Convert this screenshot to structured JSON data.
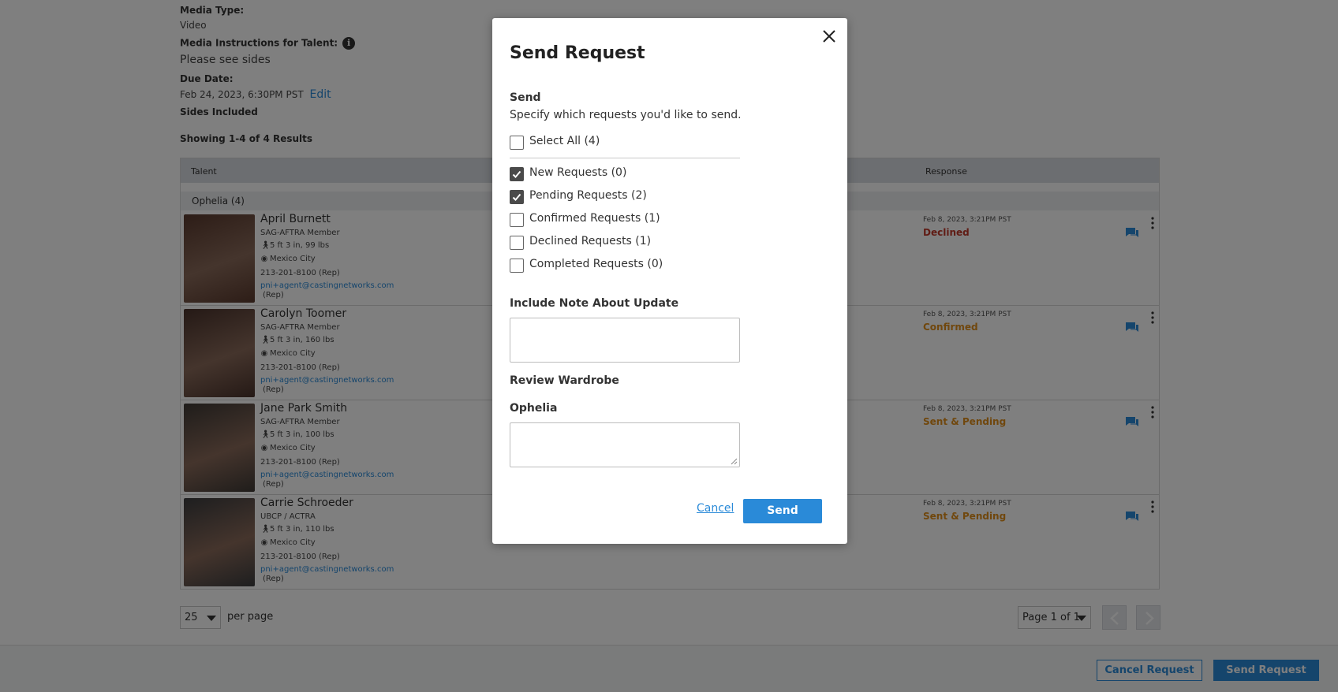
{
  "details": {
    "media_type_label": "Media Type:",
    "media_type_value": "Video",
    "instructions_label": "Media Instructions for Talent:",
    "instructions_value": "Please see sides",
    "due_date_label": "Due Date:",
    "due_date_value": "Feb 24, 2023, 6:30PM PST",
    "edit_label": "Edit",
    "sides_label": "Sides Included",
    "results_label": "Showing 1-4 of 4 Results"
  },
  "table": {
    "col_talent": "Talent",
    "col_response": "Response",
    "group_label": "Ophelia (4)",
    "rows": [
      {
        "name": "April Burnett",
        "union": "SAG-AFTRA Member",
        "size": "5 ft 3 in, 99 lbs",
        "location": "Mexico City",
        "phone": "213-201-8100 (Rep)",
        "email": "pni+agent@castingnetworks.com",
        "rep": "(Rep)",
        "date": "Feb 8, 2023, 3:21PM PST",
        "status": "Declined",
        "status_color": "#c0392b",
        "photo_color": "#5a3a2e"
      },
      {
        "name": "Carolyn Toomer",
        "union": "SAG-AFTRA Member",
        "size": "5 ft 3 in, 160 lbs",
        "location": "Mexico City",
        "phone": "213-201-8100 (Rep)",
        "email": "pni+agent@castingnetworks.com",
        "rep": "(Rep)",
        "date": "Feb 8, 2023, 3:21PM PST",
        "status": "Confirmed",
        "status_color": "#e08e1a",
        "photo_color": "#4a332c"
      },
      {
        "name": "Jane Park Smith",
        "union": "SAG-AFTRA Member",
        "size": "5 ft 3 in, 100 lbs",
        "location": "Mexico City",
        "phone": "213-201-8100 (Rep)",
        "email": "pni+agent@castingnetworks.com",
        "rep": "(Rep)",
        "date": "Feb 8, 2023, 3:21PM PST",
        "status": "Sent & Pending",
        "status_color": "#e08e1a",
        "photo_color": "#3f3a36"
      },
      {
        "name": "Carrie Schroeder",
        "union": "UBCP / ACTRA",
        "size": "5 ft 3 in, 110 lbs",
        "location": "Mexico City",
        "phone": "213-201-8100 (Rep)",
        "email": "pni+agent@castingnetworks.com",
        "rep": "(Rep)",
        "date": "Feb 8, 2023, 3:21PM PST",
        "status": "Sent & Pending",
        "status_color": "#e08e1a",
        "photo_color": "#3c3d3f"
      }
    ]
  },
  "pagination": {
    "per_page_value": "25",
    "per_page_label": "per page",
    "page_select": "Page 1 of 1"
  },
  "footer": {
    "cancel_request": "Cancel Request",
    "send_request": "Send Request"
  },
  "modal": {
    "title": "Send Request",
    "send_heading": "Send",
    "send_sub": "Specify which requests you'd like to send.",
    "select_all": "Select All (4)",
    "options": [
      {
        "label": "New Requests (0)",
        "checked": true
      },
      {
        "label": "Pending Requests (2)",
        "checked": true
      },
      {
        "label": "Confirmed Requests (1)",
        "checked": false
      },
      {
        "label": "Declined Requests (1)",
        "checked": false
      },
      {
        "label": "Completed Requests (0)",
        "checked": false
      }
    ],
    "note_heading": "Include Note About Update",
    "wardrobe_heading": "Review Wardrobe",
    "role_heading": "Ophelia",
    "cancel_label": "Cancel",
    "send_label": "Send"
  }
}
